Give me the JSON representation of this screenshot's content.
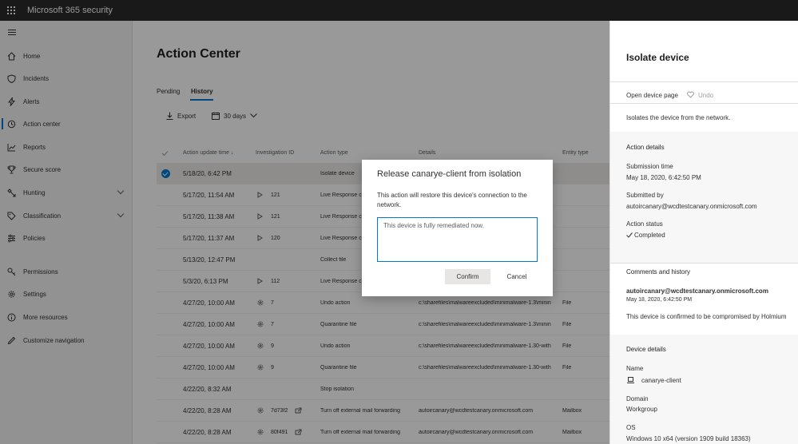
{
  "app": {
    "title": "Microsoft 365 security"
  },
  "nav": {
    "items": [
      {
        "label": "Home",
        "icon": "home-icon"
      },
      {
        "label": "Incidents",
        "icon": "shield-icon"
      },
      {
        "label": "Alerts",
        "icon": "lightning-icon"
      },
      {
        "label": "Action center",
        "icon": "action-center-icon"
      },
      {
        "label": "Reports",
        "icon": "chart-icon"
      },
      {
        "label": "Secure score",
        "icon": "trophy-icon"
      },
      {
        "label": "Hunting",
        "icon": "hunting-icon"
      },
      {
        "label": "Classification",
        "icon": "tag-icon"
      },
      {
        "label": "Policies",
        "icon": "sliders-icon"
      },
      {
        "label": "Permissions",
        "icon": "key-icon"
      },
      {
        "label": "Settings",
        "icon": "gear-icon"
      },
      {
        "label": "More resources",
        "icon": "info-icon"
      },
      {
        "label": "Customize navigation",
        "icon": "pencil-icon"
      }
    ]
  },
  "main": {
    "title": "Action Center",
    "tabs": [
      "Pending",
      "History"
    ],
    "toolbar": {
      "export_label": "Export",
      "range_label": "30 days"
    },
    "columns": [
      "Action update time",
      "Investigation ID",
      "Action type",
      "Details",
      "Entity type"
    ],
    "rows": [
      {
        "time": "5/18/20, 6:42 PM",
        "inv": "",
        "type": "Isolate device",
        "details": "",
        "entity": ""
      },
      {
        "time": "5/17/20, 11:54 AM",
        "inv": "121",
        "type": "Live Response co",
        "details": "",
        "entity": ""
      },
      {
        "time": "5/17/20, 11:38 AM",
        "inv": "121",
        "type": "Live Response co",
        "details": "",
        "entity": ""
      },
      {
        "time": "5/17/20, 11:37 AM",
        "inv": "120",
        "type": "Live Response co",
        "details": "",
        "entity": ""
      },
      {
        "time": "5/13/20, 12:47 PM",
        "inv": "",
        "type": "Collect file",
        "details": "",
        "entity": ""
      },
      {
        "time": "5/3/20, 6:13 PM",
        "inv": "112",
        "type": "Live Response co",
        "details": "",
        "entity": ""
      },
      {
        "time": "4/27/20, 10:00 AM",
        "inv": "7",
        "type": "Undo action",
        "details": "c:\\sharefiles\\malwareexcluded\\minimalware-1.3\\minin",
        "entity": "File"
      },
      {
        "time": "4/27/20, 10:00 AM",
        "inv": "7",
        "type": "Quarantine file",
        "details": "c:\\sharefiles\\malwareexcluded\\minimalware-1.3\\minin",
        "entity": "File"
      },
      {
        "time": "4/27/20, 10:00 AM",
        "inv": "9",
        "type": "Undo action",
        "details": "c:\\sharefiles\\malwareexcluded\\minimalware-1.30-with",
        "entity": "File"
      },
      {
        "time": "4/27/20, 10:00 AM",
        "inv": "9",
        "type": "Quarantine file",
        "details": "c:\\sharefiles\\malwareexcluded\\minimalware-1.30-with",
        "entity": "File"
      },
      {
        "time": "4/22/20, 8:32 AM",
        "inv": "",
        "type": "Stop isolation",
        "details": "",
        "entity": ""
      },
      {
        "time": "4/22/20, 8:28 AM",
        "inv": "7d73f2",
        "type": "Turn off external mail forwarding",
        "details": "autoircanary@wcdtestcanary.onmicrosoft.com",
        "entity": "Mailbox"
      },
      {
        "time": "4/22/20, 8:28 AM",
        "inv": "80f491",
        "type": "Turn off external mail forwarding",
        "details": "autoircanary@wcdtestcanary.onmicrosoft.com",
        "entity": "Mailbox"
      }
    ]
  },
  "panel": {
    "title": "Isolate device",
    "open_device_page": "Open device page",
    "undo": "Undo",
    "description": "Isolates the device from the network.",
    "action_details_header": "Action details",
    "submission_time_label": "Submission time",
    "submission_time": "May 18, 2020, 6:42:50 PM",
    "submitted_by_label": "Submitted by",
    "submitted_by": "autoircanary@wcdtestcanary.onmicrosoft.com",
    "action_status_label": "Action status",
    "action_status": "Completed",
    "comments_header": "Comments and history",
    "comment_author": "autoircanary@wcdtestcanary.onmicrosoft.com",
    "comment_time": "May 18, 2020, 6:42:50 PM",
    "comment_text": "This device is confirmed to be compromised by Holmium",
    "device_details_header": "Device details",
    "name_label": "Name",
    "name": "canarye-client",
    "domain_label": "Domain",
    "domain": "Workgroup",
    "os_label": "OS",
    "os": "Windows 10 x64 (version 1909 build 18363)"
  },
  "dialog": {
    "title": "Release canarye-client from isolation",
    "message": "This action will restore this device's connection to the network.",
    "comment": "This device is fully remediated now.",
    "confirm": "Confirm",
    "cancel": "Cancel"
  }
}
